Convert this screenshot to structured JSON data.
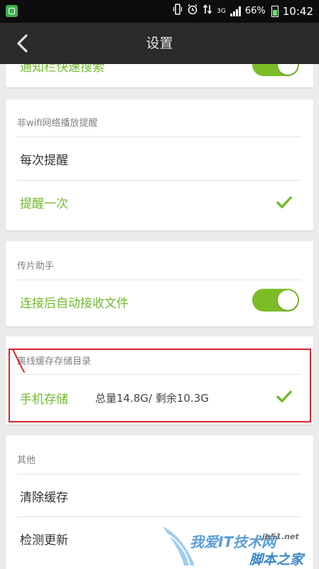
{
  "status_bar": {
    "battery_percent": "66%",
    "time": "10:42",
    "network": "3G",
    "icons": [
      "app-notification-icon",
      "vibrate-icon",
      "alarm-icon",
      "data-transfer-icon",
      "signal-icon",
      "battery-icon"
    ]
  },
  "header": {
    "title": "设置"
  },
  "sections": {
    "top_partial": {
      "label": "通知栏快速搜索"
    },
    "non_wifi": {
      "header": "非wifi网络播放提醒",
      "option_each": "每次提醒",
      "option_once": "提醒一次",
      "selected": "提醒一次"
    },
    "transfer_helper": {
      "header": "传片助手",
      "auto_receive_label": "连接后自动接收文件",
      "auto_receive_enabled": true
    },
    "offline_cache": {
      "header": "离线缓存存储目录",
      "storage_name": "手机存储",
      "storage_info": "总量14.8G/ 剩余10.3G",
      "selected": true
    },
    "other": {
      "header": "其他",
      "clear_cache": "清除缓存",
      "check_update": "检测更新"
    }
  },
  "watermark": {
    "main": "我爱IT技术网",
    "sub": "脚本之家",
    "url": "jb51.net"
  },
  "colors": {
    "accent_green": "#72b92f",
    "toggle_green": "#7cbd27",
    "highlight_red": "#d8262c",
    "header_bg": "#2a2a2a"
  }
}
